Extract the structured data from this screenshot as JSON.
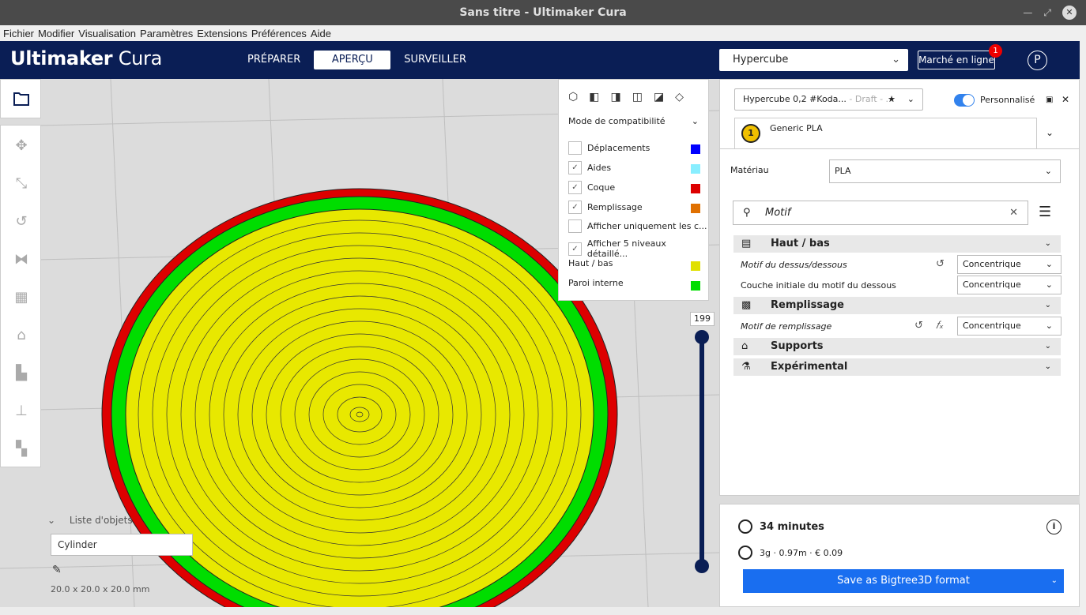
{
  "window": {
    "title": "Sans titre - Ultimaker Cura"
  },
  "menu": [
    "Fichier",
    "Modifier",
    "Visualisation",
    "Paramètres",
    "Extensions",
    "Préférences",
    "Aide"
  ],
  "header": {
    "logo_bold": "Ultimaker",
    "logo_light": " Cura",
    "stages": [
      "PRÉPARER",
      "APERÇU",
      "SURVEILLER"
    ],
    "active_stage": "APERÇU",
    "printer": "Hypercube",
    "marketplace": "Marché en ligne",
    "marketplace_badge": "1",
    "account_initial": "P"
  },
  "object_list": {
    "label": "Liste d'objets",
    "object": "Cylinder",
    "dimensions": "20.0 x 20.0 x 20.0 mm"
  },
  "color_scheme": {
    "mode": "Mode de compatibilité",
    "items": [
      {
        "label": "Déplacements",
        "checked": false,
        "color": "#0000ff"
      },
      {
        "label": "Aides",
        "checked": true,
        "color": "#88eeff"
      },
      {
        "label": "Coque",
        "checked": true,
        "color": "#dd0000"
      },
      {
        "label": "Remplissage",
        "checked": true,
        "color": "#e07000"
      },
      {
        "label": "Afficher uniquement les c...",
        "checked": false
      },
      {
        "label": "Afficher 5 niveaux détaillé...",
        "checked": true
      }
    ],
    "legend": [
      {
        "label": "Haut / bas",
        "color": "#e0e000"
      },
      {
        "label": "Paroi interne",
        "color": "#00dd00"
      }
    ]
  },
  "layer_slider": {
    "value": "199"
  },
  "settings_panel": {
    "profile": "Hypercube 0,2 #Koda...",
    "profile_quality": "- Draft - ...",
    "custom_toggle_label": "Personnalisé",
    "material_tab": "Generic PLA",
    "extruder": "1",
    "material_label": "Matériau",
    "material_value": "PLA",
    "search_value": "Motif",
    "categories": [
      {
        "name": "Haut / bas",
        "icon": "top-bottom-icon"
      },
      {
        "name": "Remplissage",
        "icon": "infill-icon"
      },
      {
        "name": "Supports",
        "icon": "support-icon"
      },
      {
        "name": "Expérimental",
        "icon": "flask-icon"
      }
    ],
    "settings": [
      {
        "label": "Motif du dessus/dessous",
        "value": "Concentrique"
      },
      {
        "label": "Couche initiale du motif du dessous",
        "value": "Concentrique"
      },
      {
        "label": "Motif de remplissage",
        "value": "Concentrique"
      }
    ]
  },
  "print_summary": {
    "time": "34 minutes",
    "material": "3g · 0.97m · € 0.09",
    "save_label": "Save as Bigtree3D format"
  }
}
